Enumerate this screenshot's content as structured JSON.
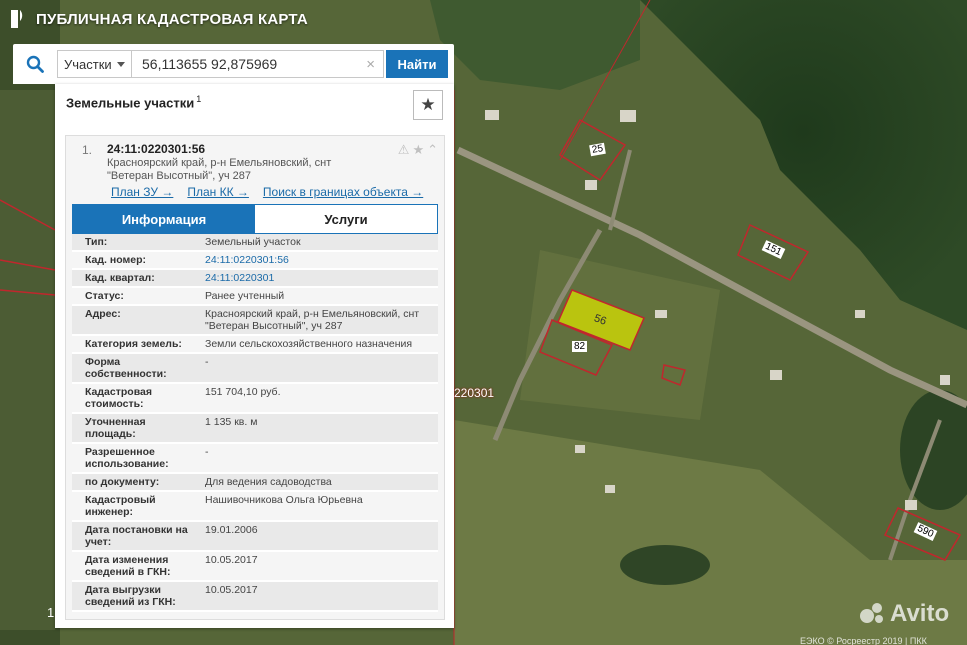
{
  "app": {
    "title": "ПУБЛИЧНАЯ КАДАСТРОВАЯ КАРТА"
  },
  "search": {
    "type_label": "Участки",
    "value": "56,113655 92,875969",
    "clear_icon": "×",
    "button_label": "Найти"
  },
  "panel": {
    "title": "Земельные участки",
    "count": "1",
    "star_icon": "★"
  },
  "result": {
    "number": "1.",
    "cadastral_id": "24:11:0220301:56",
    "address_line": "Красноярский край, р-н Емельяновский, снт \"Ветеран Высотный\", уч 287",
    "icons": {
      "warning": "⚠",
      "star": "★",
      "collapse": "⌃"
    },
    "links": [
      {
        "label": "План ЗУ →"
      },
      {
        "label": "План КК →"
      },
      {
        "label": "Поиск в границах объекта →"
      }
    ],
    "tabs": [
      {
        "label": "Информация",
        "active": true
      },
      {
        "label": "Услуги",
        "active": false
      }
    ],
    "info": [
      {
        "key": "Тип:",
        "value": "Земельный участок"
      },
      {
        "key": "Кад. номер:",
        "value": "24:11:0220301:56",
        "link": true
      },
      {
        "key": "Кад. квартал:",
        "value": "24:11:0220301",
        "link": true
      },
      {
        "key": "Статус:",
        "value": "Ранее учтенный"
      },
      {
        "key": "Адрес:",
        "value": "Красноярский край, р-н Емельяновский, снт \"Ветеран Высотный\", уч 287"
      },
      {
        "key": "Категория земель:",
        "value": "Земли сельскохозяйственного назначения"
      },
      {
        "key": "Форма собственности:",
        "value": "-"
      },
      {
        "key": "Кадастровая стоимость:",
        "value": "151 704,10 руб."
      },
      {
        "key": "Уточненная площадь:",
        "value": "1 135 кв. м"
      },
      {
        "key": "Разрешенное использование:",
        "value": "-"
      },
      {
        "key": "по документу:",
        "value": "Для ведения садоводства"
      },
      {
        "key": "Кадастровый инженер:",
        "value": "Нашивочникова Ольга Юрьевна"
      },
      {
        "key": "Дата постановки на учет:",
        "value": "19.01.2006"
      },
      {
        "key": "Дата изменения сведений в ГКН:",
        "value": "10.05.2017"
      },
      {
        "key": "Дата выгрузки сведений из ГКН:",
        "value": "10.05.2017"
      }
    ]
  },
  "map": {
    "parcel_labels": [
      "25",
      "151",
      "56",
      "82",
      "590"
    ],
    "quarter_label": "220301",
    "left_label": "1",
    "watermark": "Avito",
    "attribution": "ЕЭКО © Росреестр 2019 | ПКК",
    "colors": {
      "parcel_border": "#c0272d",
      "selected_fill": "#d8e000"
    }
  }
}
